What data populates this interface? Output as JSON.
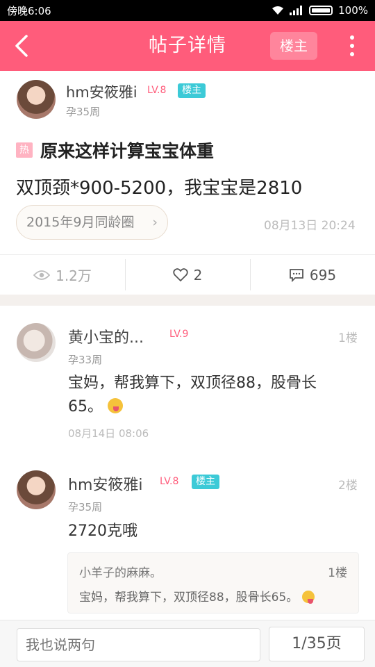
{
  "status_bar": {
    "time": "傍晚6:06",
    "battery": "100%"
  },
  "header": {
    "title": "帖子详情",
    "owner_button": "楼主"
  },
  "post": {
    "author": "hm安筱雅i",
    "level": "LV.8",
    "owner_tag": "楼主",
    "pregnancy": "孕35周",
    "hot_tag": "热",
    "title": "原来这样计算宝宝体重",
    "body": "双顶颈*900-5200，我宝宝是2810",
    "circle": "2015年9月同龄圈",
    "time": "08月13日 20:24"
  },
  "stats": {
    "views": "1.2万",
    "likes": "2",
    "comments": "695"
  },
  "comments": [
    {
      "author": "黄小宝的...",
      "level": "LV.9",
      "floor": "1楼",
      "pregnancy": "孕33周",
      "text_line1": "宝妈，帮我算下，双顶径88，股骨长",
      "text_line2": "65。",
      "time": "08月14日 08:06"
    },
    {
      "author": "hm安筱雅i",
      "level": "LV.8",
      "owner_tag": "楼主",
      "floor": "2楼",
      "pregnancy": "孕35周",
      "text": "2720克哦",
      "quote": {
        "author": "小羊子的麻麻。",
        "floor": "1楼",
        "text": "宝妈，帮我算下，双顶径88，股骨长65。"
      }
    }
  ],
  "bottom": {
    "placeholder": "我也说两句",
    "pager": "1/35页"
  }
}
